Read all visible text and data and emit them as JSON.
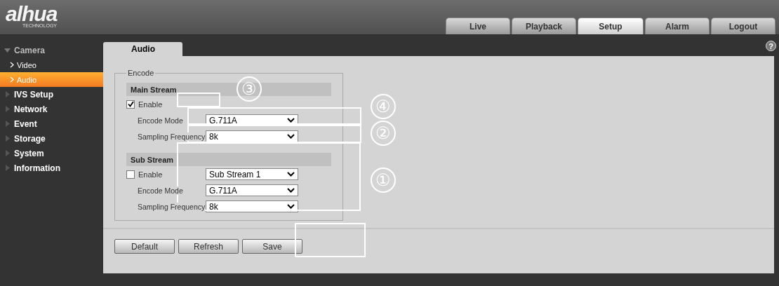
{
  "logo": {
    "text": "alhua",
    "tagline": "TECHNOLOGY"
  },
  "top_tabs": [
    {
      "label": "Live",
      "selected": false
    },
    {
      "label": "Playback",
      "selected": false
    },
    {
      "label": "Setup",
      "selected": true
    },
    {
      "label": "Alarm",
      "selected": false
    },
    {
      "label": "Logout",
      "selected": false
    }
  ],
  "sidebar": {
    "items": [
      {
        "label": "Camera",
        "expanded": true,
        "children": [
          {
            "label": "Video",
            "selected": false
          },
          {
            "label": "Audio",
            "selected": true
          }
        ]
      },
      {
        "label": "IVS Setup",
        "expanded": false
      },
      {
        "label": "Network",
        "expanded": false
      },
      {
        "label": "Event",
        "expanded": false
      },
      {
        "label": "Storage",
        "expanded": false
      },
      {
        "label": "System",
        "expanded": false
      },
      {
        "label": "Information",
        "expanded": false
      }
    ]
  },
  "page_tab": "Audio",
  "help": "?",
  "encode": {
    "legend": "Encode",
    "sections": [
      {
        "title": "Main Stream",
        "enable": {
          "label": "Enable",
          "checked": true
        },
        "rows": [
          {
            "label": "Encode Mode",
            "value": "G.711A"
          },
          {
            "label": "Sampling Frequency",
            "value": "8k"
          }
        ]
      },
      {
        "title": "Sub Stream",
        "enable": {
          "label": "Enable",
          "checked": false,
          "value": "Sub Stream 1"
        },
        "rows": [
          {
            "label": "Encode Mode",
            "value": "G.711A"
          },
          {
            "label": "Sampling Frequency",
            "value": "8k"
          }
        ]
      }
    ]
  },
  "buttons": [
    "Default",
    "Refresh",
    "Save"
  ],
  "callouts": [
    {
      "number": "③"
    },
    {
      "number": "④"
    },
    {
      "number": "②"
    },
    {
      "number": "①"
    }
  ]
}
